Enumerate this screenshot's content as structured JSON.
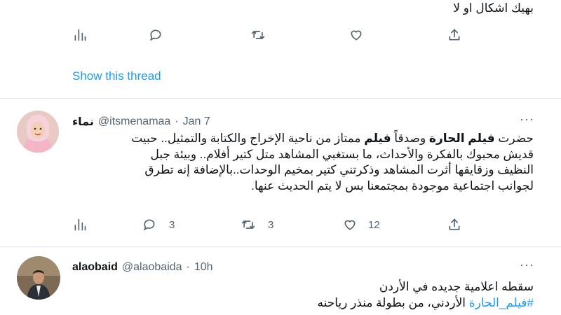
{
  "tweet0": {
    "text_tail": "بهيك اشكال او لا",
    "actions": {
      "reply": "",
      "retweet": "",
      "like": ""
    },
    "show_thread": "Show this thread"
  },
  "tweet1": {
    "display_name": "نماء",
    "handle": "@itsmenamaa",
    "sep": "·",
    "time": "Jan 7",
    "lines": [
      {
        "pre": "حضرت ",
        "bold1": "فيلم الحارة",
        "mid": " وصدقاً ",
        "bold2": "فيلم",
        "post": " ممتاز من ناحية الإخراج والكتابة والتمثيل.. حبيت"
      },
      {
        "text": "قديش محبوك بالفكرة والأحداث، ما بستغبي المشاهد متل كتير أفلام.. وبيئة جبل"
      },
      {
        "text": "النظيف وزقايقها أثرت المشاهد وذكرتني كتير بمخيم الوحدات..بالإضافة إنه تطرق"
      },
      {
        "text": "لجوانب اجتماعية موجودة بمجتمعنا بس لا يتم الحديث عنها."
      }
    ],
    "actions": {
      "reply": "3",
      "retweet": "3",
      "like": "12"
    }
  },
  "tweet2": {
    "display_name": "alaobaid",
    "handle": "@alaobaida",
    "sep": "·",
    "time": "10h",
    "line1": "سقطه اعلامية جديده في الأردن",
    "hashtag": "#فيلم_الحارة",
    "line2_rest": " الأردني، من بطولة منذر رياحنه"
  },
  "more_glyph": "···",
  "colors": {
    "accent": "#1d9bf0",
    "muted": "#536471",
    "text": "#0f1419",
    "divider": "#e5e5e5"
  },
  "icons": [
    "analytics-icon",
    "reply-icon",
    "retweet-icon",
    "like-icon",
    "share-icon",
    "more-icon"
  ]
}
